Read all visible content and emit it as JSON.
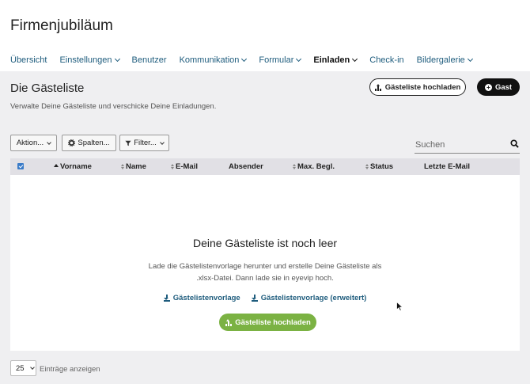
{
  "app": {
    "title": "Firmenjubiläum"
  },
  "nav": [
    {
      "label": "Übersicht",
      "dropdown": false,
      "active": false
    },
    {
      "label": "Einstellungen",
      "dropdown": true,
      "active": false
    },
    {
      "label": "Benutzer",
      "dropdown": false,
      "active": false
    },
    {
      "label": "Kommunikation",
      "dropdown": true,
      "active": false
    },
    {
      "label": "Formular",
      "dropdown": true,
      "active": false
    },
    {
      "label": "Einladen",
      "dropdown": true,
      "active": true
    },
    {
      "label": "Check-in",
      "dropdown": false,
      "active": false
    },
    {
      "label": "Bildergalerie",
      "dropdown": true,
      "active": false
    }
  ],
  "page": {
    "title": "Die Gästeliste",
    "subtitle": "Verwalte Deine Gästeliste und verschicke Deine Einladungen."
  },
  "header_buttons": {
    "upload": "Gästeliste hochladen",
    "add_guest": "Gast"
  },
  "toolbar": {
    "actions": "Aktion...",
    "columns": "Spalten...",
    "filter": "Filter..."
  },
  "search": {
    "placeholder": "Suchen"
  },
  "table": {
    "columns": [
      "Vorname",
      "Name",
      "E-Mail",
      "Absender",
      "Max. Begl.",
      "Status",
      "Letzte E-Mail"
    ]
  },
  "empty_state": {
    "title": "Deine Gästeliste ist noch leer",
    "text": "Lade die Gästelistenvorlage herunter und erstelle Deine Gästeliste als .xlsx-Datei. Dann lade sie in eyevip hoch.",
    "link_template": "Gästelistenvorlage",
    "link_template_extended": "Gästelistenvorlage (erweitert)",
    "upload_button": "Gästeliste hochladen"
  },
  "pagination": {
    "page_size": "25",
    "label": "Einträge anzeigen"
  },
  "colors": {
    "link": "#1e5c7d",
    "green": "#7bb243",
    "dark": "#111111",
    "header_bg": "#e1e0e5",
    "checkbox": "#3a7bc8"
  }
}
